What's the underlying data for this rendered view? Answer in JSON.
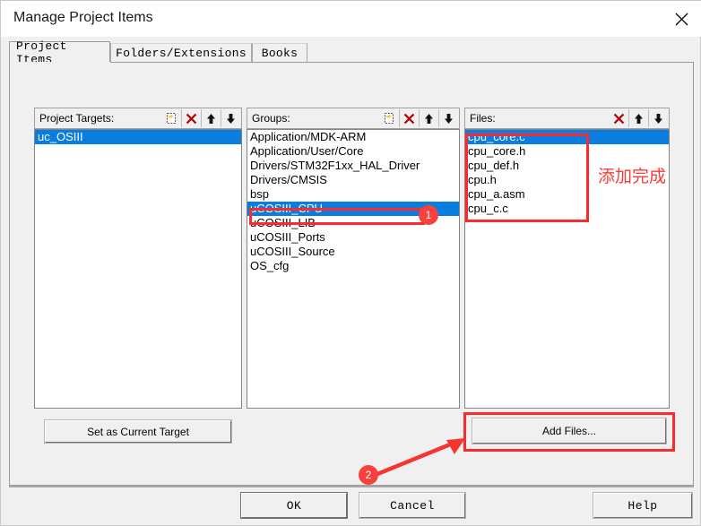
{
  "window": {
    "title": "Manage Project Items",
    "close_icon": "close-icon"
  },
  "tabs": [
    {
      "label": "Project Items",
      "active": true
    },
    {
      "label": "Folders/Extensions",
      "active": false
    },
    {
      "label": "Books",
      "active": false
    }
  ],
  "panels": {
    "targets": {
      "label": "Project Targets:",
      "tools": [
        "new-item-icon",
        "delete-icon",
        "move-up-icon",
        "move-down-icon"
      ],
      "items": [
        {
          "label": "uc_OSIII",
          "selected": true
        }
      ]
    },
    "groups": {
      "label": "Groups:",
      "tools": [
        "new-item-icon",
        "delete-icon",
        "move-up-icon",
        "move-down-icon"
      ],
      "items": [
        {
          "label": "Application/MDK-ARM",
          "selected": false
        },
        {
          "label": "Application/User/Core",
          "selected": false
        },
        {
          "label": "Drivers/STM32F1xx_HAL_Driver",
          "selected": false
        },
        {
          "label": "Drivers/CMSIS",
          "selected": false
        },
        {
          "label": "bsp",
          "selected": false
        },
        {
          "label": "uCOSIII_CPU",
          "selected": true
        },
        {
          "label": "uCOSIII_LIB",
          "selected": false
        },
        {
          "label": "uCOSIII_Ports",
          "selected": false
        },
        {
          "label": "uCOSIII_Source",
          "selected": false
        },
        {
          "label": "OS_cfg",
          "selected": false
        }
      ]
    },
    "files": {
      "label": "Files:",
      "tools": [
        "delete-icon",
        "move-up-icon",
        "move-down-icon"
      ],
      "items": [
        {
          "label": "cpu_core.c",
          "selected": true
        },
        {
          "label": "cpu_core.h",
          "selected": false
        },
        {
          "label": "cpu_def.h",
          "selected": false
        },
        {
          "label": "cpu.h",
          "selected": false
        },
        {
          "label": "cpu_a.asm",
          "selected": false
        },
        {
          "label": "cpu_c.c",
          "selected": false
        }
      ]
    }
  },
  "buttons": {
    "set_current_target": "Set as Current Target",
    "add_files": "Add Files...",
    "ok": "OK",
    "cancel": "Cancel",
    "help": "Help"
  },
  "annotations": {
    "badge_1": "1",
    "badge_2": "2",
    "note_cn": "添加完成",
    "color": "#fb2b2b"
  }
}
